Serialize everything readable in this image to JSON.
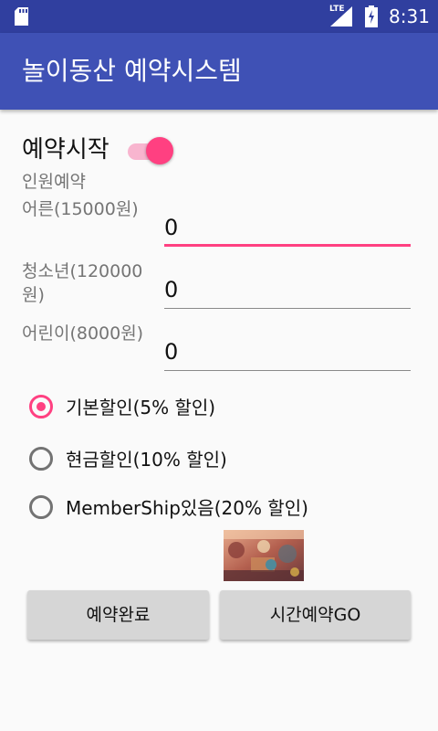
{
  "statusbar": {
    "network_label": "LTE",
    "time": "8:31",
    "icons": [
      "sd-card-icon",
      "signal-icon",
      "battery-icon"
    ]
  },
  "appbar": {
    "title": "놀이동산 예약시스템"
  },
  "colors": {
    "primary": "#3F51B5",
    "primary_dark": "#303F9F",
    "accent": "#FF4081"
  },
  "reservation": {
    "switch_label": "예약시작",
    "switch_on": true,
    "section_label": "인원예약",
    "fields": [
      {
        "label": "어른(15000원)",
        "value": "0"
      },
      {
        "label": "청소년(120000원)",
        "value": "0"
      },
      {
        "label": "어린이(8000원)",
        "value": "0"
      }
    ]
  },
  "discounts": {
    "options": [
      {
        "label": "기본할인(5% 할인)",
        "checked": true
      },
      {
        "label": "현금할인(10% 할인)",
        "checked": false
      },
      {
        "label": "MemberShip있음(20% 할인)",
        "checked": false
      }
    ]
  },
  "buttons": {
    "complete": "예약완료",
    "time_reservation": "시간예약GO"
  }
}
